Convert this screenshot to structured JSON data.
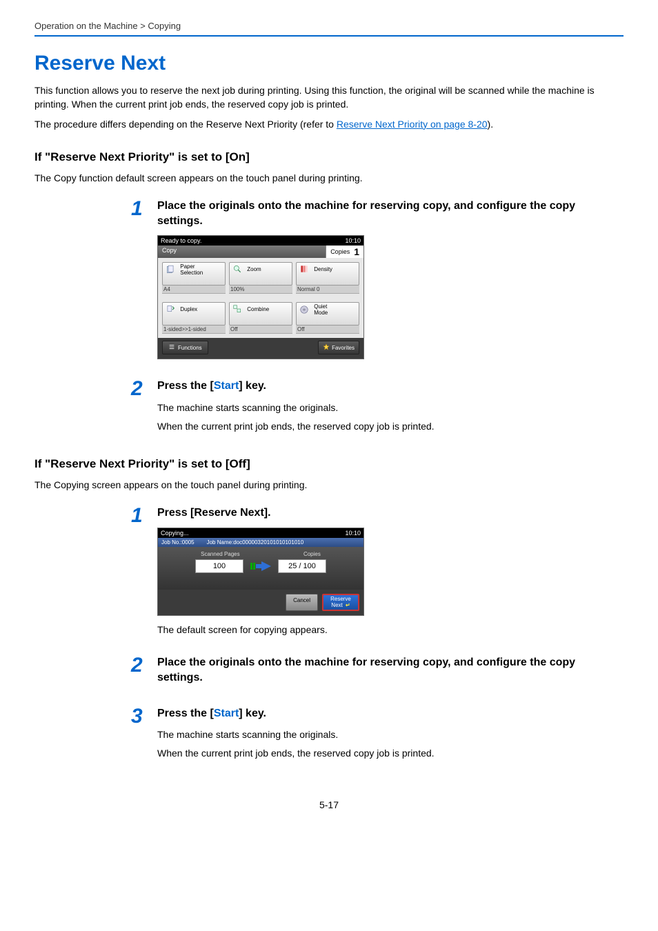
{
  "breadcrumb": "Operation on the Machine > Copying",
  "title": "Reserve Next",
  "intro1": "This function allows you to reserve the next job during printing. Using this function, the original will be scanned while the machine is printing. When the current print job ends, the reserved copy job is printed.",
  "intro2_prefix": "The procedure differs depending on the Reserve Next Priority (refer to ",
  "intro2_link": "Reserve Next Priority on page 8-20",
  "intro2_suffix": ").",
  "sectionOn": {
    "heading": "If \"Reserve Next Priority\" is set to [On]",
    "desc": "The Copy function default screen appears on the touch panel during printing.",
    "step1": {
      "title": "Place the originals onto the machine for reserving copy, and configure the copy settings."
    },
    "step2": {
      "title_pre": "Press the [",
      "title_key": "Start",
      "title_post": "] key.",
      "body1": "The machine starts scanning the originals.",
      "body2": "When the current print job ends, the reserved copy job is printed."
    }
  },
  "sectionOff": {
    "heading": "If \"Reserve Next Priority\" is set to [Off]",
    "desc": "The Copying screen appears on the touch panel during printing.",
    "step1": {
      "title": "Press [Reserve Next].",
      "after": "The default screen for copying appears."
    },
    "step2": {
      "title": "Place the originals onto the machine for reserving copy, and configure the copy settings."
    },
    "step3": {
      "title_pre": "Press the [",
      "title_key": "Start",
      "title_post": "] key.",
      "body1": "The machine starts scanning the originals.",
      "body2": "When the current print job ends, the reserved copy job is printed."
    }
  },
  "copyScreen": {
    "status": "Ready to copy.",
    "time": "10:10",
    "mode": "Copy",
    "copies_label": "Copies",
    "copies_value": "1",
    "tiles_row1": [
      {
        "label": "Paper\nSelection",
        "value": "A4"
      },
      {
        "label": "Zoom",
        "value": "100%"
      },
      {
        "label": "Density",
        "value": "Normal 0"
      }
    ],
    "tiles_row2": [
      {
        "label": "Duplex",
        "value": "1-sided>>1-sided"
      },
      {
        "label": "Combine",
        "value": "Off"
      },
      {
        "label": "Quiet\nMode",
        "value": "Off"
      }
    ],
    "functions": "Functions",
    "favorites": "Favorites"
  },
  "progressScreen": {
    "status": "Copying...",
    "time": "10:10",
    "jobno_label": "Job No.:",
    "jobno": "0005",
    "jobname_label": "Job Name:",
    "jobname": "doc00000320101010101010",
    "scanned_label": "Scanned Pages",
    "scanned": "100",
    "copies_label": "Copies",
    "copies": "25 / 100",
    "cancel": "Cancel",
    "reserve": "Reserve\nNext"
  },
  "pageNumber": "5-17"
}
